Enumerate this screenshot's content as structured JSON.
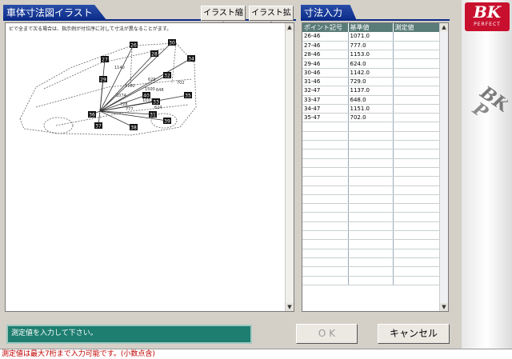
{
  "illustration": {
    "title": "車体寸法図イラスト",
    "btn_shrink": "イラスト縮小",
    "btn_enlarge": "イラスト拡大",
    "note": "ビで全まで次る場合は、指示例が付位序に対して寸法が異なることがます。",
    "point_labels": [
      "26",
      "27",
      "28",
      "29",
      "30",
      "31",
      "32",
      "33",
      "34",
      "35",
      "36",
      "37",
      "38",
      "39",
      "40"
    ],
    "dimension_labels": [
      "1140",
      "728",
      "1031",
      "1500",
      "1074",
      "1160",
      "624",
      "777",
      "702",
      "648",
      "629"
    ]
  },
  "dimensions": {
    "title": "寸法入力",
    "columns": [
      "ポイント記号",
      "基準値",
      "測定値"
    ],
    "rows": [
      {
        "point": "26-46",
        "standard": "1071.0",
        "measured": ""
      },
      {
        "point": "27-46",
        "standard": "777.0",
        "measured": ""
      },
      {
        "point": "28-46",
        "standard": "1153.0",
        "measured": ""
      },
      {
        "point": "29-46",
        "standard": "624.0",
        "measured": ""
      },
      {
        "point": "30-46",
        "standard": "1142.0",
        "measured": ""
      },
      {
        "point": "31-46",
        "standard": "729.0",
        "measured": ""
      },
      {
        "point": "32-47",
        "standard": "1137.0",
        "measured": ""
      },
      {
        "point": "33-47",
        "standard": "648.0",
        "measured": ""
      },
      {
        "point": "34-47",
        "standard": "1151.0",
        "measured": ""
      },
      {
        "point": "35-47",
        "standard": "702.0",
        "measured": ""
      }
    ],
    "empty_row_count": 18
  },
  "status_message": "測定値を入力して下さい。",
  "ok_label": "O K",
  "cancel_label": "キャンセル",
  "footer_message": "測定値は最大7桁まで入力可能です。(小数点含)",
  "brand": {
    "logo": "BK",
    "sub": "PERFECT",
    "accent": "#c8102e"
  },
  "colors": {
    "header": "#0a2a88",
    "status": "#1e7e70",
    "table_header": "#5a7c78",
    "footer_text": "#c00000"
  }
}
